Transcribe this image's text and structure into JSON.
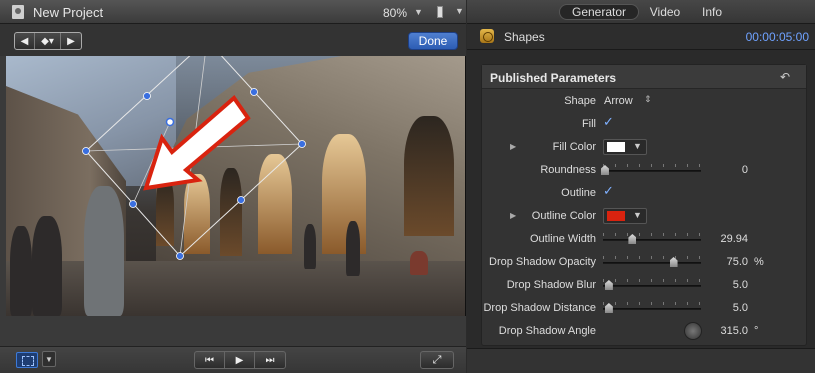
{
  "viewer": {
    "project_title": "New Project",
    "zoom": "80%",
    "done_label": "Done",
    "toolbar_icons": [
      "chevron-left-icon",
      "keyframe-icon",
      "chevron-right-icon"
    ]
  },
  "transport": {
    "prev_icon": "⏮",
    "play_icon": "▶",
    "next_icon": "⏭",
    "fullscreen_icon": "⤢"
  },
  "inspector": {
    "tabs": [
      "Generator",
      "Video",
      "Info"
    ],
    "active_tab": "Generator",
    "generator_name": "Shapes",
    "timecode": "00:00:05:00",
    "section_title": "Published Parameters",
    "params": {
      "shape": {
        "label": "Shape",
        "value": "Arrow"
      },
      "fill": {
        "label": "Fill",
        "checked": true
      },
      "fill_color": {
        "label": "Fill Color",
        "color": "#ffffff"
      },
      "roundness": {
        "label": "Roundness",
        "value": "0",
        "level": 0.0
      },
      "outline": {
        "label": "Outline",
        "checked": true
      },
      "outline_color": {
        "label": "Outline Color",
        "color": "#d9230f"
      },
      "outline_width": {
        "label": "Outline Width",
        "value": "29.94",
        "level": 0.3
      },
      "shadow_opacity": {
        "label": "Drop Shadow Opacity",
        "value": "75.0",
        "unit": "%",
        "level": 0.75
      },
      "shadow_blur": {
        "label": "Drop Shadow Blur",
        "value": "5.0",
        "level": 0.02
      },
      "shadow_distance": {
        "label": "Drop Shadow Distance",
        "value": "5.0",
        "level": 0.02
      },
      "shadow_angle": {
        "label": "Drop Shadow Angle",
        "value": "315.0",
        "unit": "°"
      }
    }
  },
  "colors": {
    "accent_blue": "#2d5db4",
    "timecode_blue": "#6fa2ff",
    "arrow_fill": "#ffffff",
    "arrow_outline": "#d9230f"
  }
}
